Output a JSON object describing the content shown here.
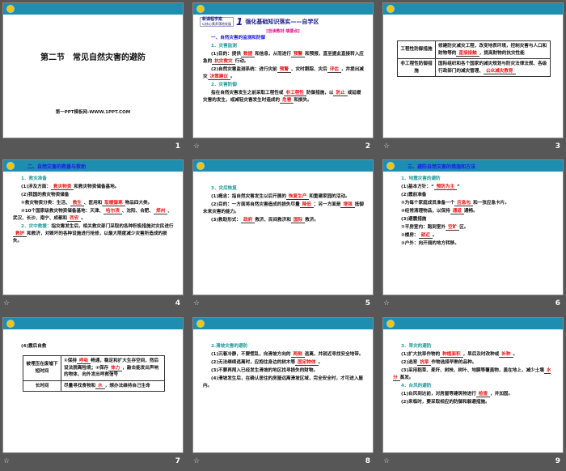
{
  "colors": {
    "background": "#575757",
    "header_bar": "#1d8db0",
    "heading_blue": "#1a1aee",
    "heading_teal": "#1f9a9a",
    "blank_red": "#ee1111"
  },
  "slides": [
    {
      "num": "1",
      "kind": "title",
      "title": "第二节　常见自然灾害的避防",
      "subtitle": "第一PPT模板网-WWW.1PPT.COM"
    },
    {
      "num": "2",
      "kind": "text",
      "star": "☆",
      "banner": {
        "badge_top": "新课程学案",
        "badge_bottom": "以核心素养落地发展",
        "number": "1",
        "title": "强化基础知识落实——自学区",
        "subtitle": "[自读教材·填要点]"
      },
      "paras": [
        {
          "s": "h1",
          "segs": [
            {
              "t": "一、自然灾害的监测和防御"
            }
          ]
        },
        {
          "s": "h2",
          "segs": [
            {
              "t": "1．灾害监测"
            }
          ]
        },
        {
          "s": "p",
          "segs": [
            {
              "t": "(1)目的：提供"
            },
            {
              "t": "数据",
              "b": 1
            },
            {
              "t": "和信息，从而进行"
            },
            {
              "t": "预警",
              "b": 1
            },
            {
              "t": "和预报，直至据此直接转入应急的"
            },
            {
              "t": "抗灾救灾",
              "b": 1
            },
            {
              "t": "行动。"
            }
          ]
        },
        {
          "s": "p",
          "segs": [
            {
              "t": "(2)自然灾害监测系统：进行灾前"
            },
            {
              "t": "预警",
              "b": 1
            },
            {
              "t": "、灾时跟踪、灾后"
            },
            {
              "t": "评估",
              "b": 1
            },
            {
              "t": "，并提出减灾"
            },
            {
              "t": "决策建议",
              "b": 1
            },
            {
              "t": "。"
            }
          ]
        },
        {
          "s": "h2",
          "segs": [
            {
              "t": "2．灾害防御"
            }
          ]
        },
        {
          "s": "p",
          "segs": [
            {
              "t": "指在自然灾害发生之前采取工程性或"
            },
            {
              "t": "非工程性",
              "b": 1
            },
            {
              "t": "防御措施，以"
            },
            {
              "t": "防止",
              "b": 1
            },
            {
              "t": "或延缓灾害的发生，或减轻灾害发生时造成的"
            },
            {
              "t": "危害",
              "b": 1
            },
            {
              "t": "和损失。"
            }
          ]
        }
      ]
    },
    {
      "num": "3",
      "kind": "table",
      "star": "☆",
      "rows": [
        {
          "head": "工程性防御措施",
          "segs": [
            {
              "t": "修建防灾减灾工程，改变地表环境，控制灾害与人口和财物等的"
            },
            {
              "t": "直接接触",
              "b": 1
            },
            {
              "t": "，提高财物的抗灾性能"
            }
          ]
        },
        {
          "head": "非工程性防御措施",
          "segs": [
            {
              "t": "国际组织和各个国家的减灾规划与防灾法律法规、各级行政部门的减灾管理、"
            },
            {
              "t": "公众减灾教育",
              "b": 1
            }
          ]
        }
      ]
    },
    {
      "num": "4",
      "kind": "text",
      "star": "☆",
      "bar_title": "二、自然灾害的救援与救助",
      "paras": [
        {
          "s": "h2",
          "segs": [
            {
              "t": "1．救灾准备"
            }
          ]
        },
        {
          "s": "p",
          "segs": [
            {
              "t": "(1)涉及方面："
            },
            {
              "t": "救灾物资",
              "b": 1
            },
            {
              "t": "和救灾物资储备基地。"
            }
          ]
        },
        {
          "s": "p",
          "segs": [
            {
              "t": "(2)我国的救灾物资储备"
            }
          ]
        },
        {
          "s": "p",
          "segs": [
            {
              "t": "①救灾物资分类：生活、"
            },
            {
              "t": "救生",
              "b": 1
            },
            {
              "t": "、医用和"
            },
            {
              "t": "取暖御寒",
              "b": 1
            },
            {
              "t": "物品四大类。"
            }
          ]
        },
        {
          "s": "p",
          "segs": [
            {
              "t": "②10个国家级救灾物资储备基地：天津、"
            },
            {
              "t": "哈尔滨",
              "b": 1
            },
            {
              "t": "、沈阳、合肥、"
            },
            {
              "t": "郑州",
              "b": 1
            },
            {
              "t": "、武汉、长沙、南宁、成都和"
            },
            {
              "t": "西安",
              "b": 1
            },
            {
              "t": "。"
            }
          ]
        },
        {
          "s": "p",
          "segs": [
            {
              "t": "2．灾中救援：",
              "h": 1
            },
            {
              "t": "指灾害发生后，相关救灾部门采取的各种积极措施对灾民进行"
            },
            {
              "t": "救护",
              "b": 1
            },
            {
              "t": "和救济，对毁坏的各种设施进行抢修，以最大限度减少灾害所造成的损失。"
            }
          ]
        }
      ]
    },
    {
      "num": "5",
      "kind": "text",
      "star": "☆",
      "paras": [
        {
          "s": "h2",
          "segs": [
            {
              "t": "3．灾后恢复"
            }
          ]
        },
        {
          "s": "p",
          "segs": [
            {
              "t": "(1)概念：指自然灾害发生以后开展的"
            },
            {
              "t": "恢复生产",
              "b": 1
            },
            {
              "t": "和重建家园的活动。"
            }
          ]
        },
        {
          "s": "p",
          "segs": [
            {
              "t": "(2)目的：一方面将自然灾害造成的损失尽量"
            },
            {
              "t": "降低",
              "b": 1
            },
            {
              "t": "；另一方面是"
            },
            {
              "t": "增强",
              "b": 1
            },
            {
              "t": "抵御未来灾害的能力。"
            }
          ]
        },
        {
          "s": "p",
          "segs": [
            {
              "t": "(3)救助形式："
            },
            {
              "t": "政府",
              "b": 1
            },
            {
              "t": "救济、民间救济和"
            },
            {
              "t": "国际",
              "b": 1
            },
            {
              "t": "救济。"
            }
          ]
        }
      ]
    },
    {
      "num": "6",
      "kind": "text",
      "star": "☆",
      "bar_title": "三、避防自然灾害的措施和方法",
      "paras": [
        {
          "s": "h2",
          "segs": [
            {
              "t": "1．地震灾害的避防"
            }
          ]
        },
        {
          "s": "p",
          "segs": [
            {
              "t": "(1)基本方针：“"
            },
            {
              "t": "预防为主",
              "b": 1
            },
            {
              "t": "”"
            }
          ]
        },
        {
          "s": "p",
          "segs": [
            {
              "t": "(2)震前准备"
            }
          ]
        },
        {
          "s": "p",
          "segs": [
            {
              "t": "①为每个家庭成员准备一个"
            },
            {
              "t": "应急包",
              "b": 1
            },
            {
              "t": "和一张应急卡片。"
            }
          ]
        },
        {
          "s": "p",
          "segs": [
            {
              "t": "②经常清理物品，以保持"
            },
            {
              "t": "通道",
              "b": 1
            },
            {
              "t": "通畅。"
            }
          ]
        },
        {
          "s": "p",
          "segs": [
            {
              "t": "(3)避震措施"
            }
          ]
        },
        {
          "s": "p",
          "segs": [
            {
              "t": "①平房室内：跑到室外"
            },
            {
              "t": "空旷",
              "b": 1
            },
            {
              "t": "区。"
            }
          ]
        },
        {
          "s": "p",
          "segs": [
            {
              "t": "②楼房："
            },
            {
              "t": "就近",
              "b": 1
            },
            {
              "t": "。"
            }
          ]
        },
        {
          "s": "p",
          "segs": [
            {
              "t": "③户外：向开阔的地方转移。"
            }
          ]
        }
      ]
    },
    {
      "num": "7",
      "kind": "table",
      "star": "☆",
      "intro": "(4)震后自救",
      "rows": [
        {
          "head": "被埋压在废墟下短时间",
          "segs": [
            {
              "t": "①保持"
            },
            {
              "t": "呼吸",
              "b": 1
            },
            {
              "t": "畅通，稳定和扩大生存空间，然后设法脱离险境；②保存"
            },
            {
              "t": "体力",
              "b": 1
            },
            {
              "t": "，敲击能发出声响的物体，向外发出呼救信号"
            }
          ]
        },
        {
          "head": "长时间",
          "segs": [
            {
              "t": "尽量寻找食物和"
            },
            {
              "t": "水",
              "b": 1
            },
            {
              "t": "，想办法维持自己生命"
            }
          ]
        }
      ]
    },
    {
      "num": "8",
      "kind": "text",
      "star": "☆",
      "paras": [
        {
          "s": "h2",
          "segs": [
            {
              "t": "2.滑坡灾害的避防"
            }
          ]
        },
        {
          "s": "p",
          "segs": [
            {
              "t": "(1)沉着冷静，不要慌乱，向滑坡方向的"
            },
            {
              "t": "两侧",
              "b": 1
            },
            {
              "t": "逃离，并就近寻找安全地带。"
            }
          ]
        },
        {
          "s": "p",
          "segs": [
            {
              "t": "(2)无法继续逃离时，应抱住身边的树木等"
            },
            {
              "t": "固定物体",
              "b": 1
            },
            {
              "t": "。"
            }
          ]
        },
        {
          "s": "p",
          "segs": [
            {
              "t": "(3)不要再闯入已经发生滑坡的地区找寻损失的财物。"
            }
          ]
        },
        {
          "s": "p",
          "segs": [
            {
              "t": "(4)滑坡发生后，在确认居住的房屋远离滑坡区域，完全安全时，才可进入屋内。"
            }
          ]
        }
      ]
    },
    {
      "num": "9",
      "kind": "text",
      "star": "☆",
      "paras": [
        {
          "s": "h2",
          "segs": [
            {
              "t": "3．旱灾的避防"
            }
          ]
        },
        {
          "s": "p",
          "segs": [
            {
              "t": "(1)扩大抗旱作物的"
            },
            {
              "t": "种植面积",
              "b": 1
            },
            {
              "t": "，旱后及时改种或"
            },
            {
              "t": "补种",
              "b": 1
            },
            {
              "t": "。"
            }
          ]
        },
        {
          "s": "p",
          "segs": [
            {
              "t": "(2)选育"
            },
            {
              "t": "抗旱",
              "b": 1
            },
            {
              "t": "作物选择早熟的品种。"
            }
          ]
        },
        {
          "s": "p",
          "segs": [
            {
              "t": "(3)采用稻草、麦秆、树枝、树叶、地膜等覆盖物，盖在地上，减少土壤"
            },
            {
              "t": "水分",
              "b": 1
            },
            {
              "t": "蒸发。"
            }
          ]
        },
        {
          "s": "h2",
          "segs": [
            {
              "t": "4．台风的避防"
            }
          ]
        },
        {
          "s": "p",
          "segs": [
            {
              "t": "(1)台风到达前，对房屋等建筑物进行"
            },
            {
              "t": "检查",
              "b": 1
            },
            {
              "t": "，并加固。"
            }
          ]
        },
        {
          "s": "p",
          "segs": [
            {
              "t": "(2)来临时，要采取相应的防御和躲避措施。"
            }
          ]
        }
      ]
    }
  ]
}
